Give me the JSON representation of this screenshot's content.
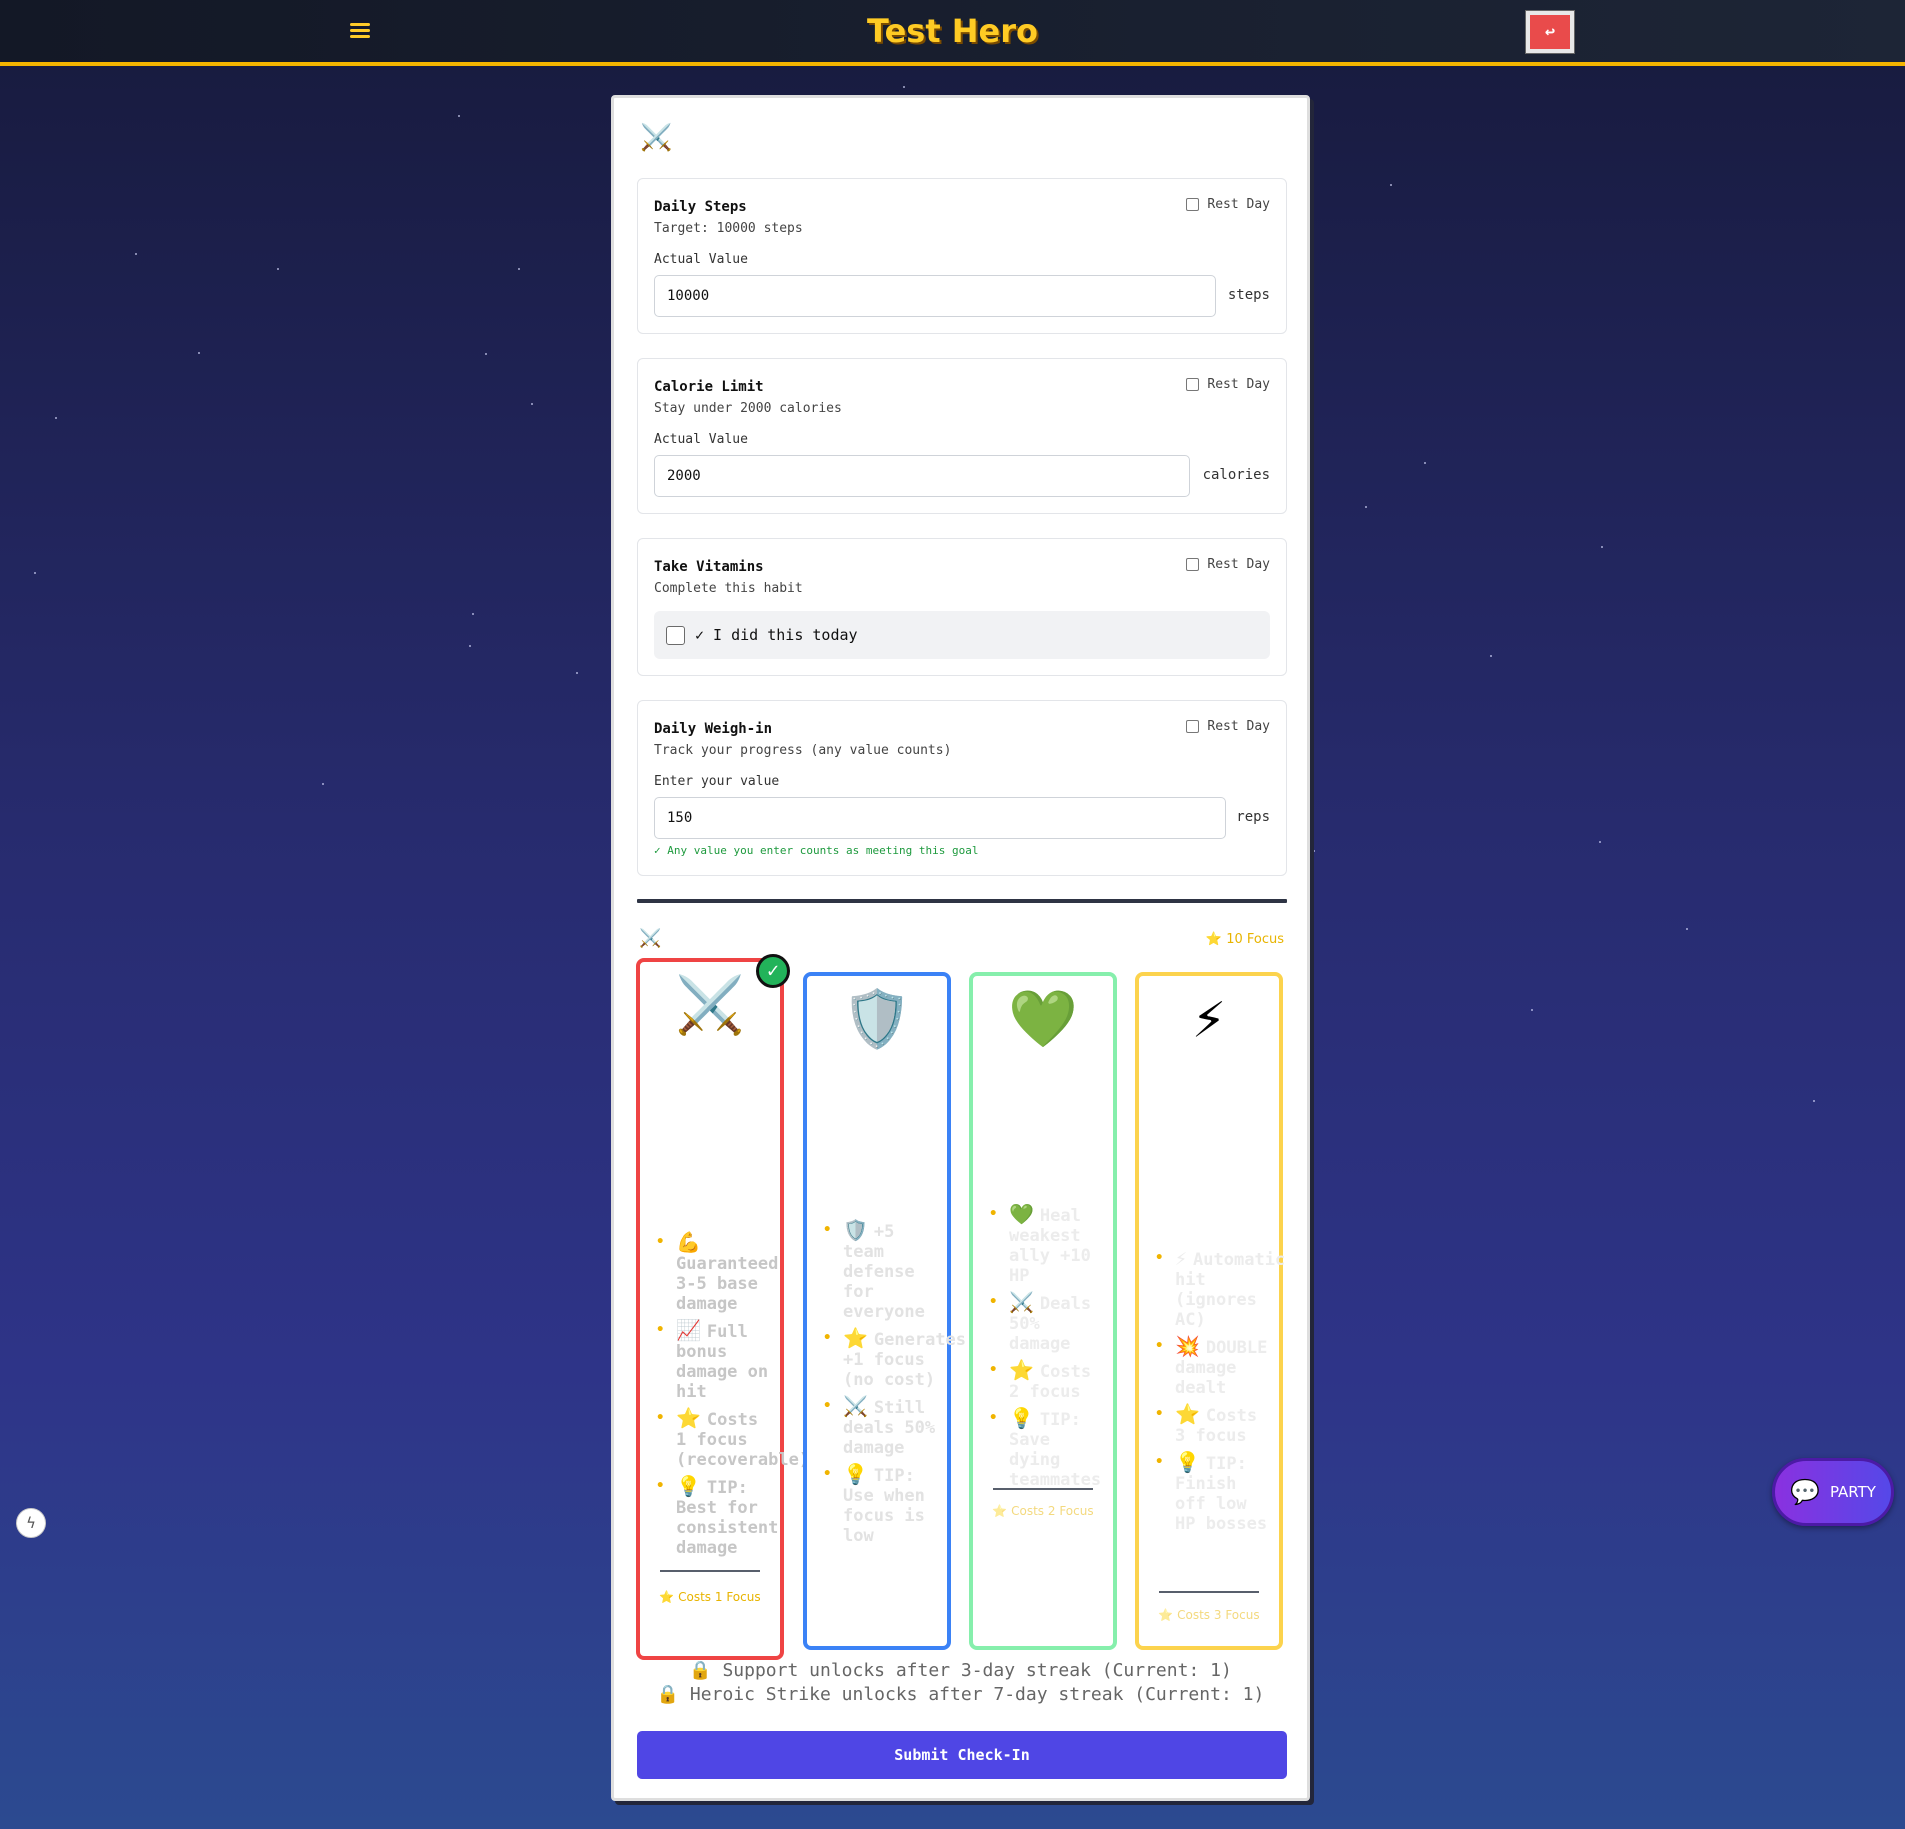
{
  "header": {
    "app_title": "Test Hero",
    "back_icon": "↩"
  },
  "panel": {
    "top_icon": "⚔️"
  },
  "goals": [
    {
      "title": "Daily Steps",
      "subtitle": "Target: 10000 steps",
      "rest_day_label": "Rest Day",
      "field_label": "Actual Value",
      "value": "10000",
      "unit": "steps"
    },
    {
      "title": "Calorie Limit",
      "subtitle": "Stay under 2000 calories",
      "rest_day_label": "Rest Day",
      "field_label": "Actual Value",
      "value": "2000",
      "unit": "calories"
    },
    {
      "title": "Take Vitamins",
      "subtitle": "Complete this habit",
      "rest_day_label": "Rest Day",
      "habit_label": "✓ I did this today"
    },
    {
      "title": "Daily Weigh-in",
      "subtitle": "Track your progress (any value counts)",
      "rest_day_label": "Rest Day",
      "field_label": "Enter your value",
      "value": "150",
      "unit": "reps",
      "note": "✓ Any value you enter counts as meeting this goal"
    }
  ],
  "strategy": {
    "icon": "⚔️",
    "focus_total": "⭐ 10 Focus",
    "actions": [
      {
        "icon": "⚔️",
        "color": "#ef4444",
        "selected": true,
        "check": "✓",
        "bullets": [
          {
            "icon": "💪",
            "text": "Guaranteed 3-5 base damage"
          },
          {
            "icon": "📈",
            "text": "Full bonus damage on hit"
          },
          {
            "icon": "⭐",
            "text": "Costs 1 focus (recoverable)"
          },
          {
            "icon": "💡",
            "text": "TIP: Best for consistent damage"
          }
        ],
        "cost": "⭐ Costs 1 Focus"
      },
      {
        "icon": "🛡️",
        "color": "#3b82f6",
        "selected": false,
        "bullets": [
          {
            "icon": "🛡️",
            "text": "+5 team defense for everyone"
          },
          {
            "icon": "⭐",
            "text": "Generates +1 focus (no cost)"
          },
          {
            "icon": "⚔️",
            "text": "Still deals 50% damage"
          },
          {
            "icon": "💡",
            "text": "TIP: Use when focus is low"
          }
        ]
      },
      {
        "icon": "💚",
        "color": "#86efac",
        "selected": false,
        "bullets": [
          {
            "icon": "💚",
            "text": "Heal weakest ally +10 HP"
          },
          {
            "icon": "⚔️",
            "text": "Deals 50% damage"
          },
          {
            "icon": "⭐",
            "text": "Costs 2 focus"
          },
          {
            "icon": "💡",
            "text": "TIP: Save dying teammates"
          }
        ],
        "cost": "⭐ Costs 2 Focus"
      },
      {
        "icon": "⚡",
        "color": "#fcd34d",
        "selected": false,
        "bullets": [
          {
            "icon": "⚡",
            "text": "Automatic hit (ignores AC)"
          },
          {
            "icon": "💥",
            "text": "DOUBLE damage dealt"
          },
          {
            "icon": "⭐",
            "text": "Costs 3 focus"
          },
          {
            "icon": "💡",
            "text": "TIP: Finish off low HP bosses"
          }
        ],
        "cost": "⭐ Costs 3 Focus"
      }
    ],
    "locked": [
      "🔒 Support unlocks after 3-day streak (Current: 1)",
      "🔒 Heroic Strike unlocks after 7-day streak (Current: 1)"
    ]
  },
  "submit_label": "Submit Check-In",
  "side_button_icon": "ϟ",
  "party": {
    "icon": "💬",
    "label": "PARTY"
  }
}
